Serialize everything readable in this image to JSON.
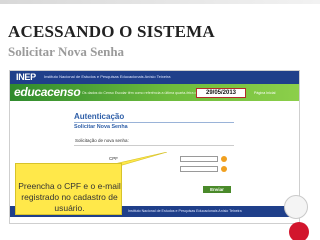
{
  "slide": {
    "title": "ACESSANDO O SISTEMA",
    "subtitle": "Solicitar Nova  Senha"
  },
  "screenshot": {
    "inep_logo": "INEP",
    "inep_name": "Instituto Nacional de Estudos e Pesquisas Educacionais Anísio Teixeira",
    "brand_logo": "educacenso",
    "brand_message": "Os dados do Censo Escolar têm como referência a última quarta-feira do mês de maio",
    "date": "29/05/2013",
    "brand_right": "Página Inicial",
    "auth_title": "Autenticação",
    "auth_subtitle": "Solicitar Nova Senha",
    "form_header": "Solicitação de nova senha:",
    "cpf_label": "CPF",
    "email_label": "E-mail",
    "send_button": "Enviar",
    "footer_text": "Instituto Nacional de Estudos e Pesquisas Educacionais Anísio Teixeira"
  },
  "callout": {
    "text": "Preencha o CPF e o e-mail registrado no cadastro de usuário."
  },
  "colors": {
    "inep_blue": "#1f3f8a",
    "brand_green": "#6dbb3c",
    "callout_yellow": "#ffe84a",
    "accent_red": "#d2162d"
  }
}
